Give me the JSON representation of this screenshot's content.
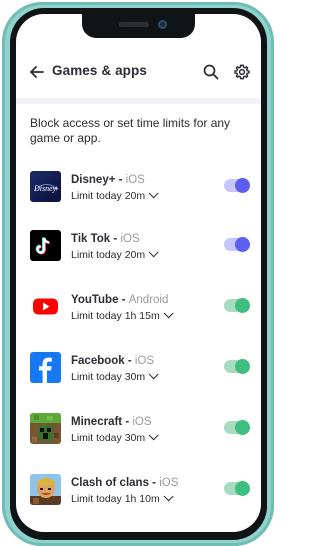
{
  "header": {
    "title": "Games & apps"
  },
  "description": "Block access or set time limits for any game or app.",
  "colors": {
    "purple_track": "#c5c6ff",
    "purple_knob": "#5b5ef0",
    "green_track": "#a8dcc0",
    "green_knob": "#3fbf7f"
  },
  "apps": [
    {
      "name": "Disney+",
      "sep": " - ",
      "platform": "iOS",
      "limit": "Limit today 20m",
      "icon": "disney-plus-icon",
      "toggle": "purple",
      "enabled": true
    },
    {
      "name": "Tik Tok",
      "sep": " - ",
      "platform": "iOS",
      "limit": "Limit today 20m",
      "icon": "tiktok-icon",
      "toggle": "purple",
      "enabled": true
    },
    {
      "name": "YouTube",
      "sep": " - ",
      "platform": "Android",
      "limit": "Limit today 1h 15m",
      "icon": "youtube-icon",
      "toggle": "green",
      "enabled": true
    },
    {
      "name": "Facebook",
      "sep": " - ",
      "platform": "iOS",
      "limit": "Limit today 30m",
      "icon": "facebook-icon",
      "toggle": "green",
      "enabled": true
    },
    {
      "name": "Minecraft",
      "sep": " - ",
      "platform": "iOS",
      "limit": "Limit today 30m",
      "icon": "minecraft-icon",
      "toggle": "green",
      "enabled": true
    },
    {
      "name": "Clash of clans",
      "sep": " - ",
      "platform": "iOS",
      "limit": "Limit today 1h 10m",
      "icon": "clash-of-clans-icon",
      "toggle": "green",
      "enabled": true
    }
  ]
}
